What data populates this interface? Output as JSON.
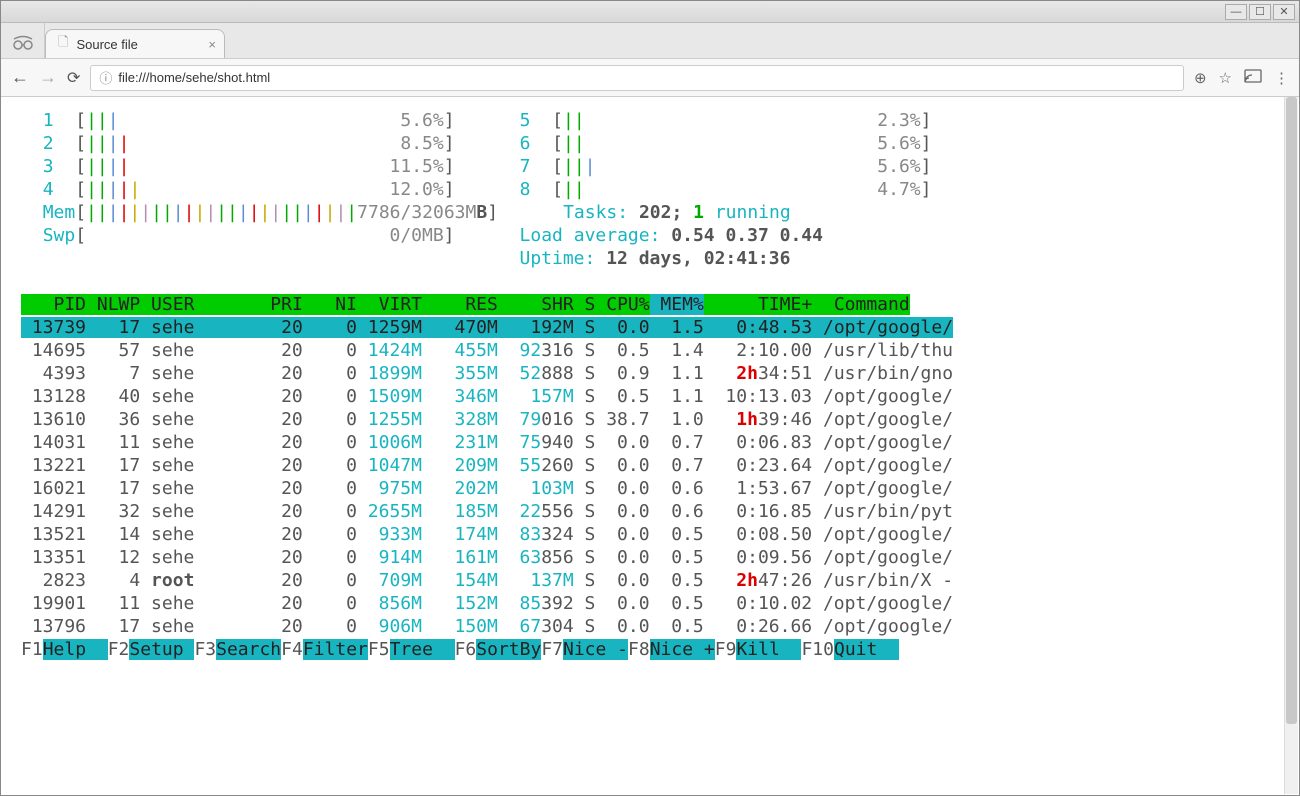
{
  "window": {
    "min": "—",
    "max": "☐",
    "close": "✕"
  },
  "tab": {
    "title": "Source file"
  },
  "address": "file:///home/sehe/shot.html",
  "cpus_left": [
    {
      "id": "1",
      "bars": "|||",
      "pct": "5.6%"
    },
    {
      "id": "2",
      "bars": "||||",
      "pct": "8.5%"
    },
    {
      "id": "3",
      "bars": "||||",
      "pct": "11.5%"
    },
    {
      "id": "4",
      "bars": "|||||",
      "pct": "12.0%"
    }
  ],
  "cpus_right": [
    {
      "id": "5",
      "bars": "||",
      "pct": "2.3%"
    },
    {
      "id": "6",
      "bars": "||",
      "pct": "5.6%"
    },
    {
      "id": "7",
      "bars": "|||",
      "pct": "5.6%"
    },
    {
      "id": "8",
      "bars": "||",
      "pct": "4.7%"
    }
  ],
  "mem": {
    "label": "Mem",
    "bars": "|||||||||||||||||||||||||",
    "text": "7786/32063MB"
  },
  "swp": {
    "label": "Swp",
    "text": "0/0MB"
  },
  "tasks": {
    "label": "Tasks:",
    "total": "202",
    "running": "1",
    "running_label": "running"
  },
  "load": {
    "label": "Load average:",
    "v1": "0.54",
    "v2": "0.37",
    "v3": "0.44"
  },
  "uptime": {
    "label": "Uptime:",
    "value": "12 days, 02:41:36"
  },
  "headers": [
    "PID",
    "NLWP",
    "USER",
    "PRI",
    "NI",
    "VIRT",
    "RES",
    "SHR",
    "S",
    "CPU%",
    "MEM%",
    "TIME+",
    "Command"
  ],
  "rows": [
    {
      "pid": "13739",
      "nlwp": "17",
      "user": "sehe",
      "pri": "20",
      "ni": "0",
      "virt": "1259M",
      "res": "470M",
      "shr": "192M",
      "shr_low": "",
      "s": "S",
      "cpu": "0.0",
      "mem": "1.5",
      "time": "0:48.53",
      "time_hl": "",
      "cmd": "/opt/google/",
      "sel": true
    },
    {
      "pid": "14695",
      "nlwp": "57",
      "user": "sehe",
      "pri": "20",
      "ni": "0",
      "virt": "1424M",
      "res": "455M",
      "shr": "92",
      "shr_low": "316",
      "s": "S",
      "cpu": "0.5",
      "mem": "1.4",
      "time": "2:10.00",
      "time_hl": "",
      "cmd": "/usr/lib/thu"
    },
    {
      "pid": "4393",
      "nlwp": "7",
      "user": "sehe",
      "pri": "20",
      "ni": "0",
      "virt": "1899M",
      "res": "355M",
      "shr": "52",
      "shr_low": "888",
      "s": "S",
      "cpu": "0.9",
      "mem": "1.1",
      "time": "34:51",
      "time_hl": "2h",
      "cmd": "/usr/bin/gno"
    },
    {
      "pid": "13128",
      "nlwp": "40",
      "user": "sehe",
      "pri": "20",
      "ni": "0",
      "virt": "1509M",
      "res": "346M",
      "shr": "157M",
      "shr_low": "",
      "s": "S",
      "cpu": "0.5",
      "mem": "1.1",
      "time": "10:13.03",
      "time_hl": "",
      "cmd": "/opt/google/"
    },
    {
      "pid": "13610",
      "nlwp": "36",
      "user": "sehe",
      "pri": "20",
      "ni": "0",
      "virt": "1255M",
      "res": "328M",
      "shr": "79",
      "shr_low": "016",
      "s": "S",
      "cpu": "38.7",
      "mem": "1.0",
      "time": "39:46",
      "time_hl": "1h",
      "cmd": "/opt/google/"
    },
    {
      "pid": "14031",
      "nlwp": "11",
      "user": "sehe",
      "pri": "20",
      "ni": "0",
      "virt": "1006M",
      "res": "231M",
      "shr": "75",
      "shr_low": "940",
      "s": "S",
      "cpu": "0.0",
      "mem": "0.7",
      "time": "0:06.83",
      "time_hl": "",
      "cmd": "/opt/google/"
    },
    {
      "pid": "13221",
      "nlwp": "17",
      "user": "sehe",
      "pri": "20",
      "ni": "0",
      "virt": "1047M",
      "res": "209M",
      "shr": "55",
      "shr_low": "260",
      "s": "S",
      "cpu": "0.0",
      "mem": "0.7",
      "time": "0:23.64",
      "time_hl": "",
      "cmd": "/opt/google/"
    },
    {
      "pid": "16021",
      "nlwp": "17",
      "user": "sehe",
      "pri": "20",
      "ni": "0",
      "virt": "975M",
      "res": "202M",
      "shr": "103M",
      "shr_low": "",
      "s": "S",
      "cpu": "0.0",
      "mem": "0.6",
      "time": "1:53.67",
      "time_hl": "",
      "cmd": "/opt/google/"
    },
    {
      "pid": "14291",
      "nlwp": "32",
      "user": "sehe",
      "pri": "20",
      "ni": "0",
      "virt": "2655M",
      "res": "185M",
      "shr": "22",
      "shr_low": "556",
      "s": "S",
      "cpu": "0.0",
      "mem": "0.6",
      "time": "0:16.85",
      "time_hl": "",
      "cmd": "/usr/bin/pyt"
    },
    {
      "pid": "13521",
      "nlwp": "14",
      "user": "sehe",
      "pri": "20",
      "ni": "0",
      "virt": "933M",
      "res": "174M",
      "shr": "83",
      "shr_low": "324",
      "s": "S",
      "cpu": "0.0",
      "mem": "0.5",
      "time": "0:08.50",
      "time_hl": "",
      "cmd": "/opt/google/"
    },
    {
      "pid": "13351",
      "nlwp": "12",
      "user": "sehe",
      "pri": "20",
      "ni": "0",
      "virt": "914M",
      "res": "161M",
      "shr": "63",
      "shr_low": "856",
      "s": "S",
      "cpu": "0.0",
      "mem": "0.5",
      "time": "0:09.56",
      "time_hl": "",
      "cmd": "/opt/google/"
    },
    {
      "pid": "2823",
      "nlwp": "4",
      "user": "root",
      "user_bold": true,
      "pri": "20",
      "ni": "0",
      "virt": "709M",
      "res": "154M",
      "shr": "137M",
      "shr_low": "",
      "s": "S",
      "cpu": "0.0",
      "mem": "0.5",
      "time": "47:26",
      "time_hl": "2h",
      "cmd": "/usr/bin/X -"
    },
    {
      "pid": "19901",
      "nlwp": "11",
      "user": "sehe",
      "pri": "20",
      "ni": "0",
      "virt": "856M",
      "res": "152M",
      "shr": "85",
      "shr_low": "392",
      "s": "S",
      "cpu": "0.0",
      "mem": "0.5",
      "time": "0:10.02",
      "time_hl": "",
      "cmd": "/opt/google/"
    },
    {
      "pid": "13796",
      "nlwp": "17",
      "user": "sehe",
      "pri": "20",
      "ni": "0",
      "virt": "906M",
      "res": "150M",
      "shr": "67",
      "shr_low": "304",
      "s": "S",
      "cpu": "0.0",
      "mem": "0.5",
      "time": "0:26.66",
      "time_hl": "",
      "cmd": "/opt/google/"
    }
  ],
  "fkeys": [
    {
      "k": "F1",
      "l": "Help  "
    },
    {
      "k": "F2",
      "l": "Setup "
    },
    {
      "k": "F3",
      "l": "Search"
    },
    {
      "k": "F4",
      "l": "Filter"
    },
    {
      "k": "F5",
      "l": "Tree  "
    },
    {
      "k": "F6",
      "l": "SortBy"
    },
    {
      "k": "F7",
      "l": "Nice -"
    },
    {
      "k": "F8",
      "l": "Nice +"
    },
    {
      "k": "F9",
      "l": "Kill  "
    },
    {
      "k": "F10",
      "l": "Quit  "
    }
  ]
}
